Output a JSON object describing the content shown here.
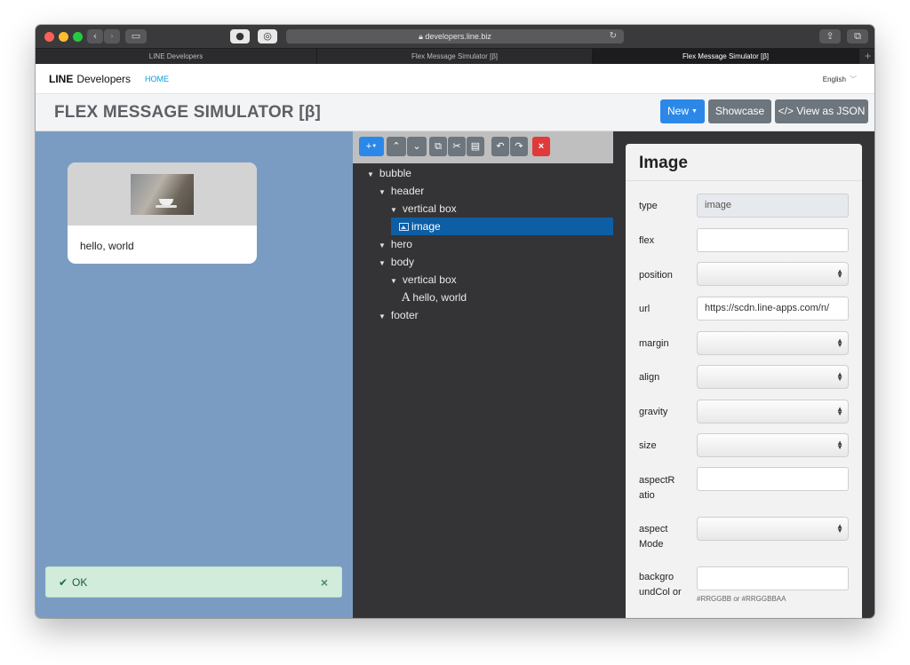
{
  "browser": {
    "address": "developers.line.biz",
    "tabs": [
      "LINE Developers",
      "Flex Message Simulator [β]",
      "Flex Message Simulator [β]"
    ],
    "new_tab_symbol": "+"
  },
  "site_header": {
    "brand_bold": "LINE",
    "brand_light": "Developers",
    "home": "HOME",
    "language": "English"
  },
  "sim_header": {
    "title": "FLEX MESSAGE SIMULATOR [β]",
    "new_button": "New",
    "showcase_button": "Showcase",
    "json_button": "</> View as JSON"
  },
  "preview": {
    "body_text": "hello, world",
    "status_text": "OK"
  },
  "tree": {
    "items": [
      "bubble",
      "header",
      "vertical box",
      "image",
      "hero",
      "body",
      "vertical box",
      "hello, world",
      "footer"
    ]
  },
  "properties": {
    "title": "Image",
    "fields": {
      "type": {
        "label": "type",
        "value": "image"
      },
      "flex": {
        "label": "flex",
        "value": ""
      },
      "position": {
        "label": "position",
        "value": ""
      },
      "url": {
        "label": "url",
        "value": "https://scdn.line-apps.com/n/"
      },
      "margin": {
        "label": "margin",
        "value": ""
      },
      "align": {
        "label": "align",
        "value": ""
      },
      "gravity": {
        "label": "gravity",
        "value": ""
      },
      "size": {
        "label": "size",
        "value": ""
      },
      "aspectRatio": {
        "label": "aspectR atio",
        "value": ""
      },
      "aspectMode": {
        "label": "aspect Mode",
        "value": ""
      },
      "backgroundColor": {
        "label": "backgro undCol or",
        "value": "",
        "hint": "#RRGGBB or #RRGGBBAA"
      }
    }
  },
  "colors": {
    "primary": "#2c88e8",
    "secondary": "#6d757d",
    "danger": "#e03a3a",
    "preview_bg": "#7b9cc2",
    "tree_bg": "#343436",
    "selected": "#0d5ea5",
    "success_bg": "#d2ecdb"
  }
}
